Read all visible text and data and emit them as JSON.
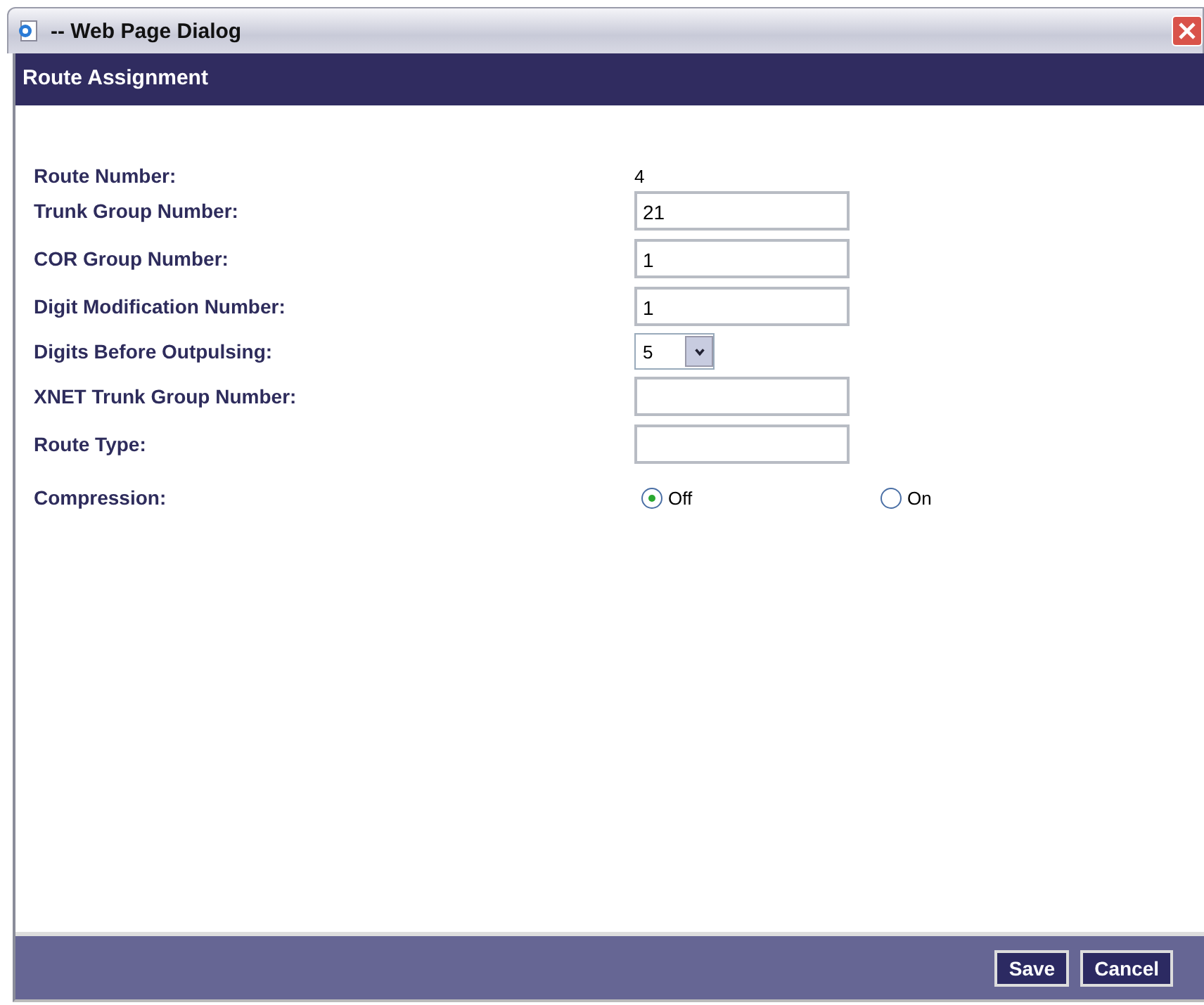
{
  "window": {
    "title": "-- Web Page Dialog"
  },
  "header": "Route Assignment",
  "fields": [
    {
      "kind": "text",
      "label": "Route Number:",
      "value": "4"
    },
    {
      "kind": "input",
      "label": "Trunk Group Number:",
      "value": "21"
    },
    {
      "kind": "input",
      "label": "COR Group Number:",
      "value": "1"
    },
    {
      "kind": "input",
      "label": "Digit Modification Number:",
      "value": "1"
    },
    {
      "kind": "select",
      "label": "Digits Before Outpulsing:",
      "value": "5"
    },
    {
      "kind": "input",
      "label": "XNET Trunk Group Number:"
    },
    {
      "kind": "input",
      "label": "Route Type:"
    },
    {
      "kind": "radio",
      "label": "Compression:",
      "options": [
        {
          "label": "Off",
          "selected": true
        },
        {
          "label": "On",
          "selected": false
        }
      ]
    }
  ],
  "buttons": [
    "Save",
    "Cancel"
  ]
}
